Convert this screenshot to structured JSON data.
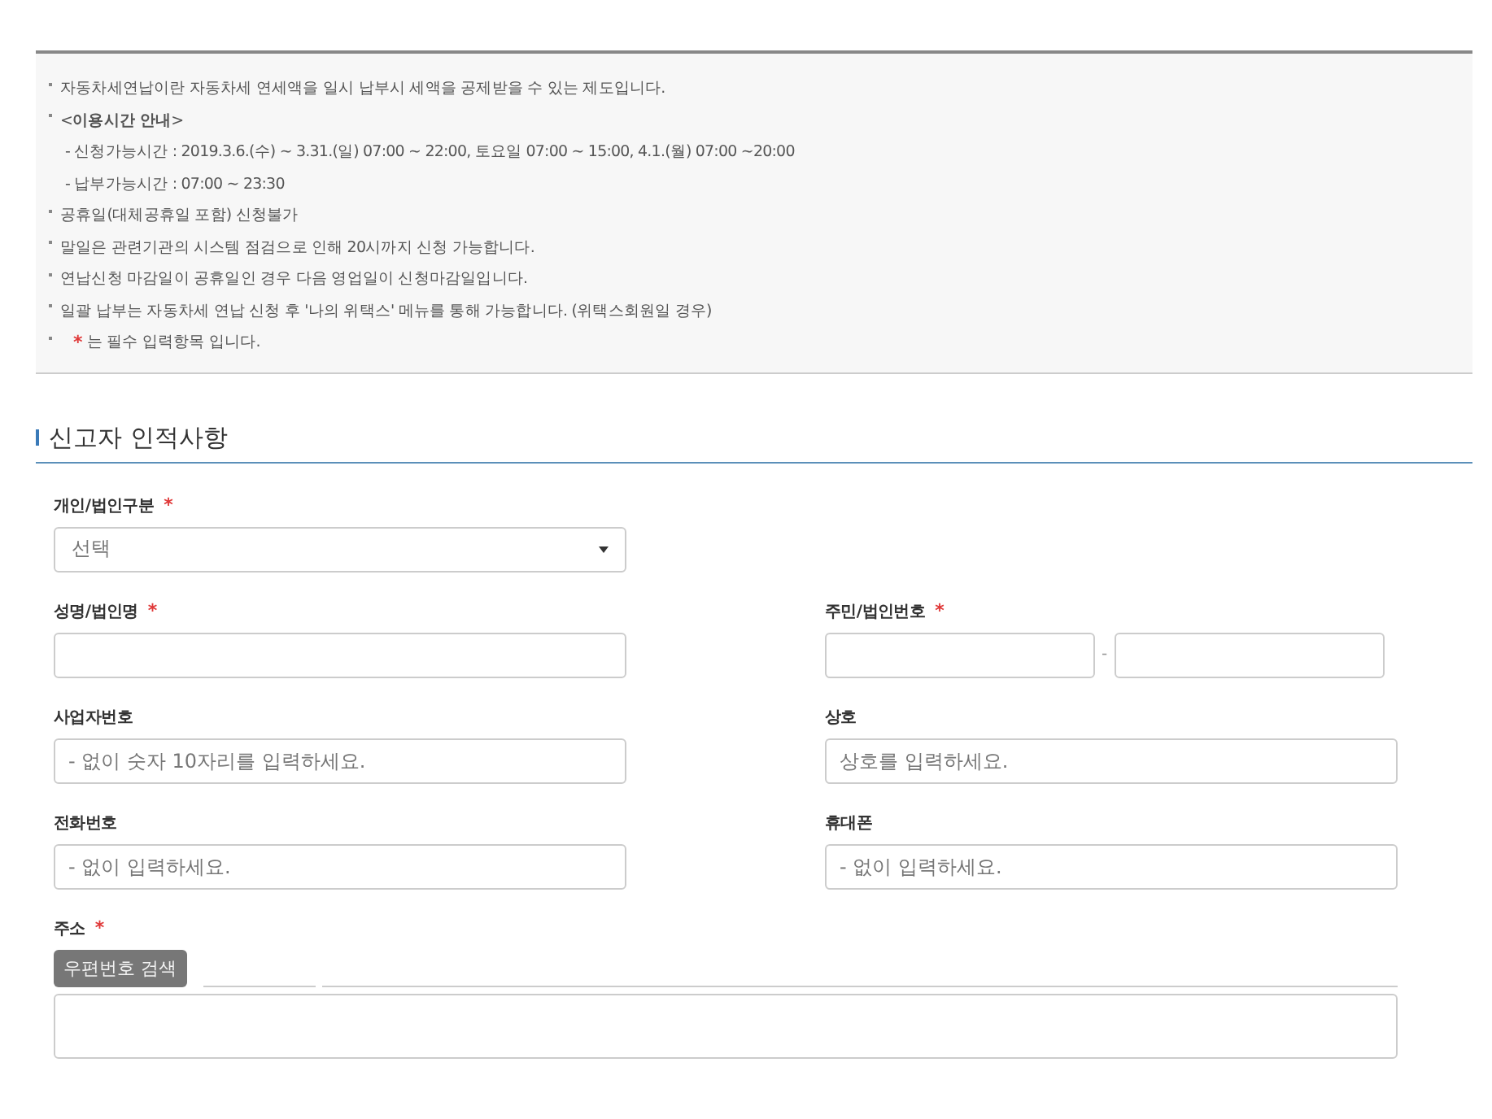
{
  "notice": {
    "lines": [
      {
        "kind": "bullet",
        "text": "자동차세연납이란 자동차세 연세액을 일시 납부시 세액을 공제받을 수 있는 제도입니다."
      },
      {
        "kind": "bullet",
        "text": "<**이용시간 안내**>"
      },
      {
        "kind": "sub",
        "text": "- 신청가능시간 : 2019.3.6.(수) ~ 3.31.(일) 07:00 ~ 22:00, 토요일 07:00 ~ 15:00, 4.1.(월) 07:00 ~20:00"
      },
      {
        "kind": "sub",
        "text": "- 납부가능시간 : 07:00 ~ 23:30"
      },
      {
        "kind": "bullet",
        "text": "공휴일(대체공휴일 포함) 신청불가"
      },
      {
        "kind": "bullet",
        "text": "말일은 관련기관의 시스템 점검으로 인해 20시까지 신청 가능합니다."
      },
      {
        "kind": "bullet",
        "text": "연납신청 마감일이 공휴일인 경우 다음 영업일이 신청마감일입니다."
      },
      {
        "kind": "bullet",
        "text": "일괄 납부는 자동차세 연납 신청 후 '나의 위택스' 메뉴를 통해 가능합니다. (위택스회원일 경우)"
      },
      {
        "kind": "required",
        "mark": "*",
        "text": "는 필수 입력항목 입니다."
      }
    ]
  },
  "section": {
    "title": "신고자 인적사항"
  },
  "rows": [
    {
      "fields": [
        {
          "label": "개인/법인구분",
          "required_mark": "*",
          "kind": "select",
          "value": "선택"
        }
      ]
    },
    {
      "fields": [
        {
          "label": "성명/법인명",
          "required_mark": "*",
          "kind": "text"
        },
        {
          "label": "주민/법인번호",
          "required_mark": "*",
          "kind": "split",
          "separator": "-"
        }
      ]
    },
    {
      "fields": [
        {
          "label": "사업자번호",
          "kind": "text",
          "placeholder": "- 없이 숫자 10자리를 입력하세요."
        },
        {
          "label": "상호",
          "kind": "text",
          "placeholder": "상호를 입력하세요."
        }
      ]
    },
    {
      "fields": [
        {
          "label": "전화번호",
          "kind": "text",
          "placeholder": "- 없이 입력하세요."
        },
        {
          "label": "휴대폰",
          "kind": "text",
          "placeholder": "- 없이 입력하세요."
        }
      ]
    },
    {
      "fields": [
        {
          "label": "주소",
          "required_mark": "*",
          "kind": "address",
          "button": "우편번호 검색"
        }
      ]
    }
  ]
}
